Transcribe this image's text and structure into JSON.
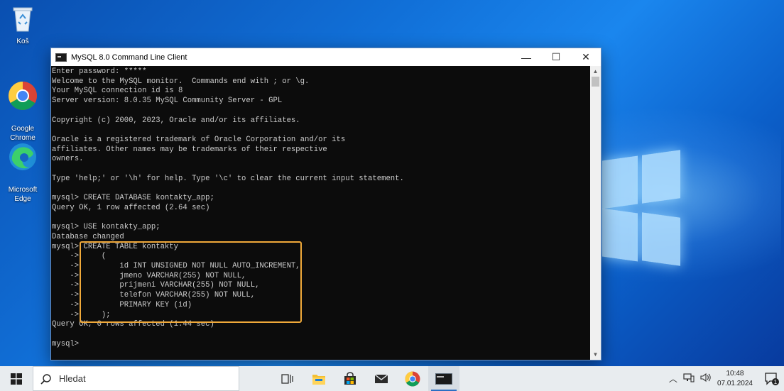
{
  "desktop": {
    "icons": [
      {
        "label": "Koš"
      },
      {
        "label": "Google\nChrome"
      },
      {
        "label": "Microsoft\nEdge"
      }
    ]
  },
  "window": {
    "title": "MySQL 8.0 Command Line Client",
    "minimize_glyph": "—",
    "maximize_glyph": "☐",
    "close_glyph": "✕"
  },
  "console": {
    "lines": [
      "Enter password: *****",
      "Welcome to the MySQL monitor.  Commands end with ; or \\g.",
      "Your MySQL connection id is 8",
      "Server version: 8.0.35 MySQL Community Server - GPL",
      "",
      "Copyright (c) 2000, 2023, Oracle and/or its affiliates.",
      "",
      "Oracle is a registered trademark of Oracle Corporation and/or its",
      "affiliates. Other names may be trademarks of their respective",
      "owners.",
      "",
      "Type 'help;' or '\\h' for help. Type '\\c' to clear the current input statement.",
      "",
      "mysql> CREATE DATABASE kontakty_app;",
      "Query OK, 1 row affected (2.64 sec)",
      "",
      "mysql> USE kontakty_app;",
      "Database changed",
      "mysql> CREATE TABLE kontakty",
      "    ->     (",
      "    ->         id INT UNSIGNED NOT NULL AUTO_INCREMENT,",
      "    ->         jmeno VARCHAR(255) NOT NULL,",
      "    ->         prijmeni VARCHAR(255) NOT NULL,",
      "    ->         telefon VARCHAR(255) NOT NULL,",
      "    ->         PRIMARY KEY (id)",
      "    ->     );",
      "Query OK, 0 rows affected (1.44 sec)",
      "",
      "mysql>"
    ]
  },
  "taskbar": {
    "search_label": "Hledat",
    "apps": [
      "task-view",
      "file-explorer",
      "microsoft-store",
      "mail",
      "google-chrome",
      "mysql-client"
    ],
    "tray": {
      "chevron": "^",
      "time": "10:48",
      "date": "07.01.2024",
      "notification_count": "1"
    }
  },
  "colors": {
    "highlight": "#f0a93a",
    "console_bg": "#0c0c0c",
    "console_fg": "#cccccc"
  }
}
